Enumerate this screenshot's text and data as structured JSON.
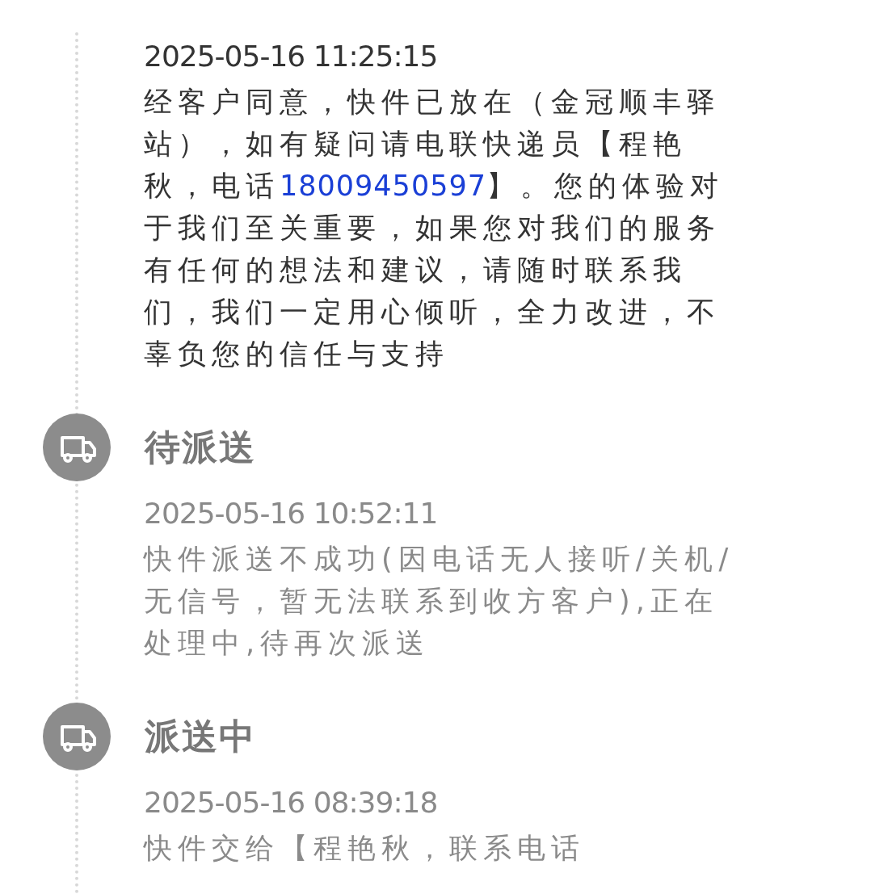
{
  "entries": [
    {
      "current": true,
      "time": "2025-05-16 11:25:15",
      "segments": [
        {
          "kind": "text",
          "text": "经客户同意，快件已放在（金冠顺丰驿站），如有疑问请电联快递员【程艳秋，电话"
        },
        {
          "kind": "phone",
          "text": "18009450597"
        },
        {
          "kind": "text",
          "text": "】。您的体验对于我们至关重要，如果您对我们的服务有任何的想法和建议，请随时联系我们，我们一定用心倾听，全力改进，不辜负您的信任与支持"
        }
      ]
    },
    {
      "current": false,
      "status": "待派送",
      "time": "2025-05-16 10:52:11",
      "segments": [
        {
          "kind": "text",
          "text": "快件派送不成功(因电话无人接听/关机/无信号，暂无法联系到收方客户),正在处理中,待再次派送"
        }
      ]
    },
    {
      "current": false,
      "status": "派送中",
      "time": "2025-05-16 08:39:18",
      "segments": [
        {
          "kind": "text",
          "text": "快件交给【程艳秋，联系电话"
        }
      ]
    }
  ]
}
